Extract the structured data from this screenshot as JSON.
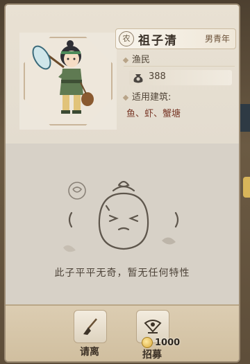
{
  "character": {
    "class_badge": "农",
    "name": "祖子清",
    "tag": "男青年",
    "occupation": "渔民",
    "wealth": "388",
    "building_label": "适用建筑:",
    "buildings": "鱼、虾、蟹塘"
  },
  "traits": {
    "empty_message": "此子平平无奇，暂无任何特性"
  },
  "actions": {
    "dismiss_label": "请离",
    "recruit_label": "招募",
    "recruit_cost": "1000"
  },
  "icons": {
    "dismiss": "broom-icon",
    "recruit": "fan-scroll-icon",
    "cost": "coin-icon",
    "wealth": "money-bag-icon"
  },
  "colors": {
    "panel": "#dcd6cc",
    "bottom_bar": "#d4c3a4",
    "text_dark": "#3a3128"
  }
}
